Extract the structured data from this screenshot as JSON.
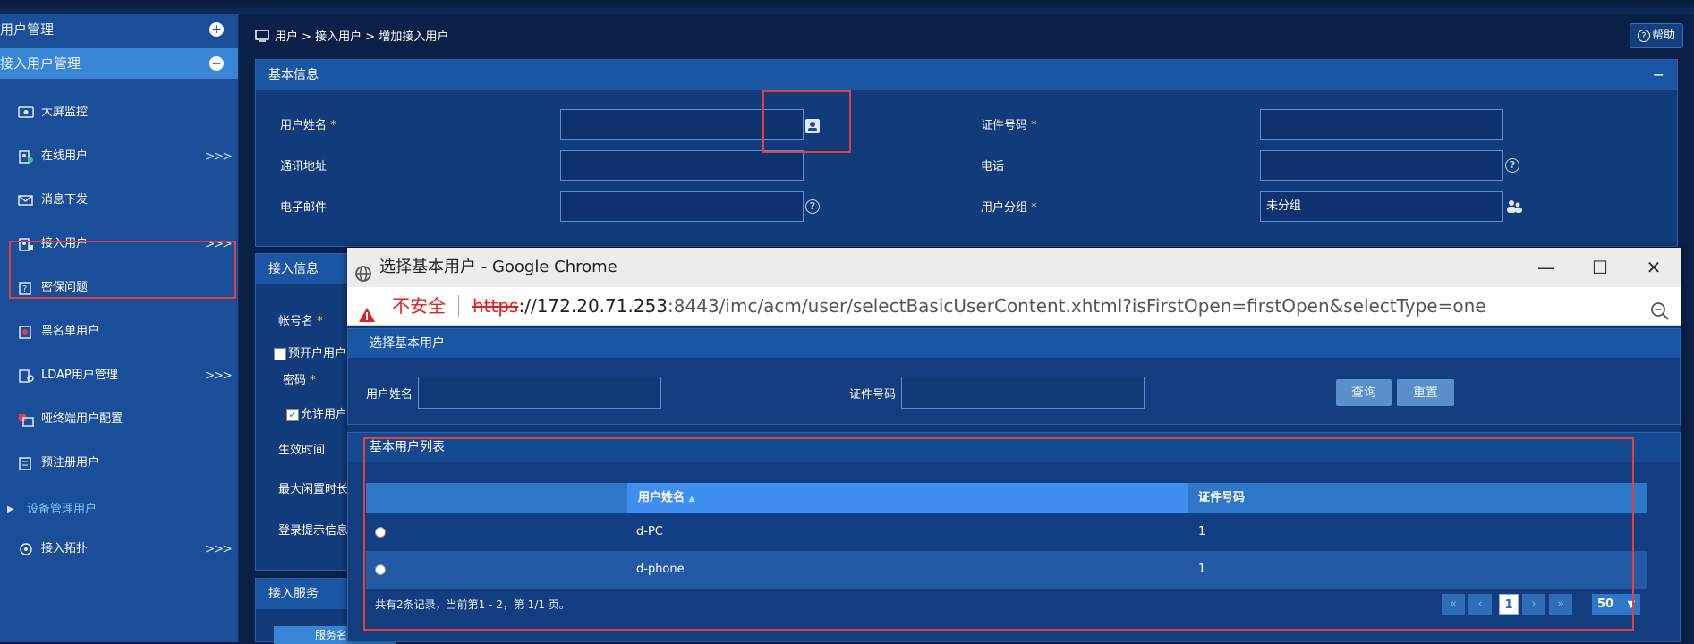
{
  "sidebar": {
    "section_title": "用户管理",
    "group_title": "接入用户管理",
    "items": [
      {
        "label": "大屏监控",
        "icon": "monitor-icon",
        "arrow": ""
      },
      {
        "label": "在线用户",
        "icon": "online-user-icon",
        "arrow": ">>>"
      },
      {
        "label": "消息下发",
        "icon": "message-icon",
        "arrow": ""
      },
      {
        "label": "接入用户",
        "icon": "access-user-icon",
        "arrow": ">>>"
      },
      {
        "label": "密保问题",
        "icon": "security-question-icon",
        "arrow": ""
      },
      {
        "label": "黑名单用户",
        "icon": "blacklist-icon",
        "arrow": ""
      },
      {
        "label": "LDAP用户管理",
        "icon": "ldap-icon",
        "arrow": ">>>"
      },
      {
        "label": "哑终端用户配置",
        "icon": "dumb-terminal-icon",
        "arrow": ""
      },
      {
        "label": "预注册用户",
        "icon": "preregister-icon",
        "arrow": ""
      }
    ],
    "sub_group": "设备管理用户",
    "last_item": {
      "label": "接入拓扑",
      "arrow": ">>>"
    }
  },
  "breadcrumb": "用户 > 接入用户 > 增加接入用户",
  "help_label": "帮助",
  "basic_info": {
    "title": "基本信息",
    "minimize": "−",
    "fields": {
      "user_name": {
        "label": "用户姓名",
        "required": "*",
        "value": ""
      },
      "id_number": {
        "label": "证件号码",
        "required": "*",
        "value": ""
      },
      "address": {
        "label": "通讯地址",
        "value": ""
      },
      "phone": {
        "label": "电话",
        "value": ""
      },
      "email": {
        "label": "电子邮件",
        "value": ""
      },
      "user_group": {
        "label": "用户分组",
        "required": "*",
        "value": "未分组"
      }
    }
  },
  "access_info": {
    "title": "接入信息",
    "account_label": "帐号名",
    "required": "*",
    "preopen_label": "预开户用户",
    "password_label": "密码",
    "allow_label": "允许用户",
    "effective_label": "生效时间",
    "idle_label": "最大闲置时长",
    "login_prompt_label": "登录提示信息"
  },
  "access_service": {
    "title": "接入服务",
    "col": "服务名"
  },
  "popup": {
    "window_title": "选择基本用户 - Google Chrome",
    "controls": {
      "minimize": "—",
      "maximize": "☐",
      "close": "✕"
    },
    "insecure": "不安全",
    "url_scheme": "https",
    "url_host": "://172.20.71.253",
    "url_path": ":8443/imc/acm/user/selectBasicUserContent.xhtml?isFirstOpen=firstOpen&selectType=one",
    "search": {
      "title": "选择基本用户",
      "name_label": "用户姓名",
      "name_value": "",
      "id_label": "证件号码",
      "id_value": "",
      "query_button": "查询",
      "reset_button": "重置"
    },
    "list": {
      "title": "基本用户列表",
      "columns": [
        "",
        "用户姓名",
        "证件号码"
      ],
      "sort_indicator": "▲",
      "rows": [
        {
          "name": "d-PC",
          "id": "1"
        },
        {
          "name": "d-phone",
          "id": "1"
        }
      ],
      "summary": "共有2条记录，当前第1 - 2，第 1/1 页。",
      "pager": {
        "first": "«",
        "prev": "‹",
        "current": "1",
        "next": "›",
        "last": "»",
        "page_size": "50"
      }
    }
  },
  "colors": {
    "accent": "#3f8ef0",
    "highlight": "#e2403f",
    "sidebar": "#1a4e98"
  }
}
